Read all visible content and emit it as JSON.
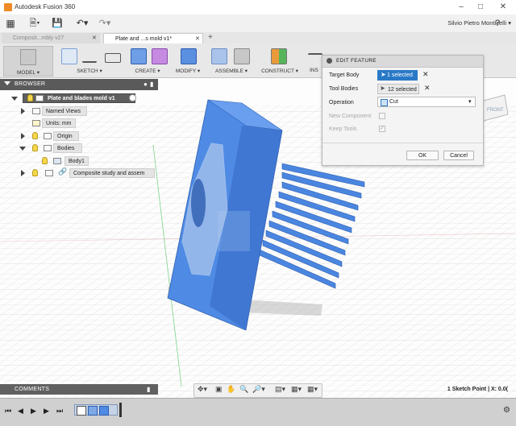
{
  "app": {
    "title": "Autodesk Fusion 360",
    "user": "Silvio Pietro Monticelli"
  },
  "tabs": [
    {
      "label": "Composit...mbly v27"
    },
    {
      "label": "Plate and ...s mold v1*"
    }
  ],
  "toolbar": {
    "workspace": "MODEL",
    "groups": [
      "SKETCH",
      "CREATE",
      "MODIFY",
      "ASSEMBLE",
      "CONSTRUCT",
      "INS"
    ]
  },
  "browser": {
    "header": "BROWSER",
    "root": "Plate and blades mold v1",
    "items": {
      "named_views": "Named Views",
      "units": "Units: mm",
      "origin": "Origin",
      "bodies": "Bodies",
      "body1": "Body1",
      "component": "Composite study and assem"
    }
  },
  "dialog": {
    "title": "EDIT FEATURE",
    "target_body_label": "Target Body",
    "target_body_value": "1 selected",
    "tool_bodies_label": "Tool Bodies",
    "tool_bodies_value": "12 selected",
    "operation_label": "Operation",
    "operation_value": "Cut",
    "new_component_label": "New Component",
    "keep_tools_label": "Keep Tools",
    "ok": "OK",
    "cancel": "Cancel"
  },
  "comments": "COMMENTS",
  "status": "1 Sketch Point | X: 0.0(",
  "viewcube_label": "FRONT",
  "colors": {
    "accent": "#2a79c6",
    "body_blue": "#4a86e0",
    "body_blue_dark": "#3568c2",
    "grid": "#cfcfcf"
  }
}
